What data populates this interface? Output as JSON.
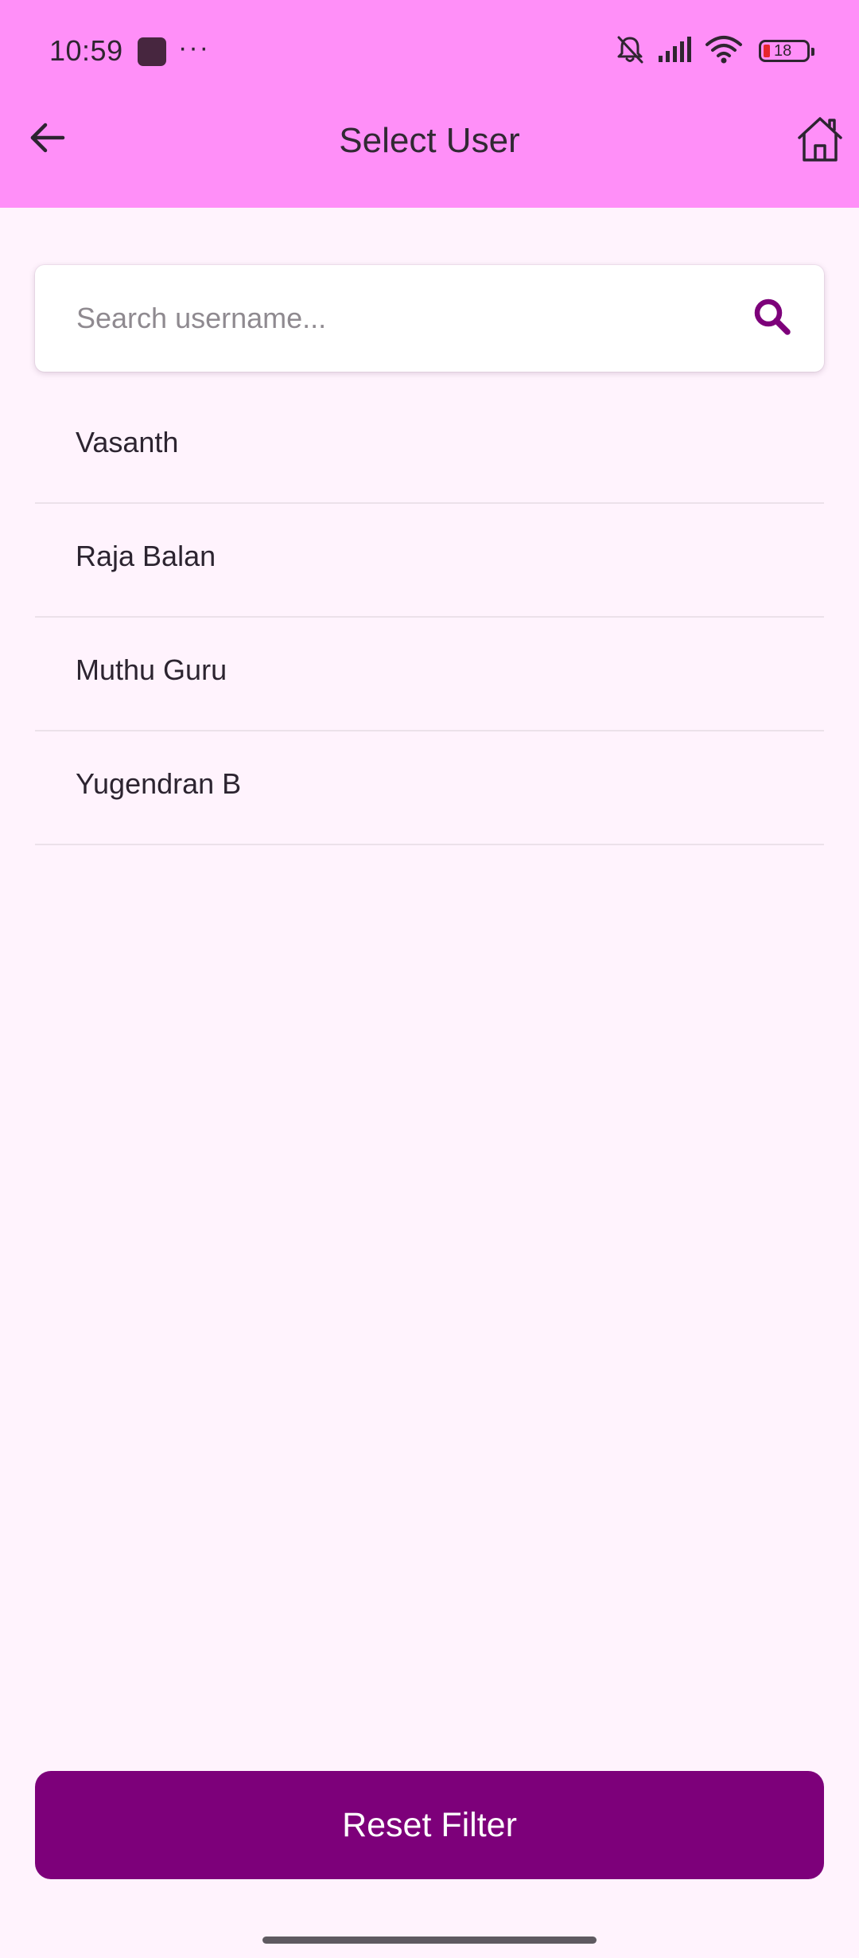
{
  "status_bar": {
    "time": "10:59",
    "dots": "···",
    "battery_level": "18",
    "icons": [
      "app-icon",
      "more-dots-icon",
      "mute-bell-icon",
      "cell-signal-icon",
      "wifi-icon",
      "battery-icon"
    ]
  },
  "header": {
    "title": "Select User",
    "back_icon": "arrow-left-icon",
    "home_icon": "home-icon",
    "background": "#ff8ff8"
  },
  "search": {
    "placeholder": "Search username...",
    "value": "",
    "icon": "search-icon",
    "accent": "#7d007a"
  },
  "users": [
    {
      "name": "Vasanth"
    },
    {
      "name": "Raja Balan"
    },
    {
      "name": "Muthu Guru"
    },
    {
      "name": "Yugendran B"
    }
  ],
  "footer": {
    "reset_label": "Reset Filter",
    "button_color": "#7d007a"
  },
  "colors": {
    "page_background": "#fff3fd",
    "header_background": "#ff8ff8",
    "accent": "#7d007a",
    "battery_low": "#e6262e"
  }
}
